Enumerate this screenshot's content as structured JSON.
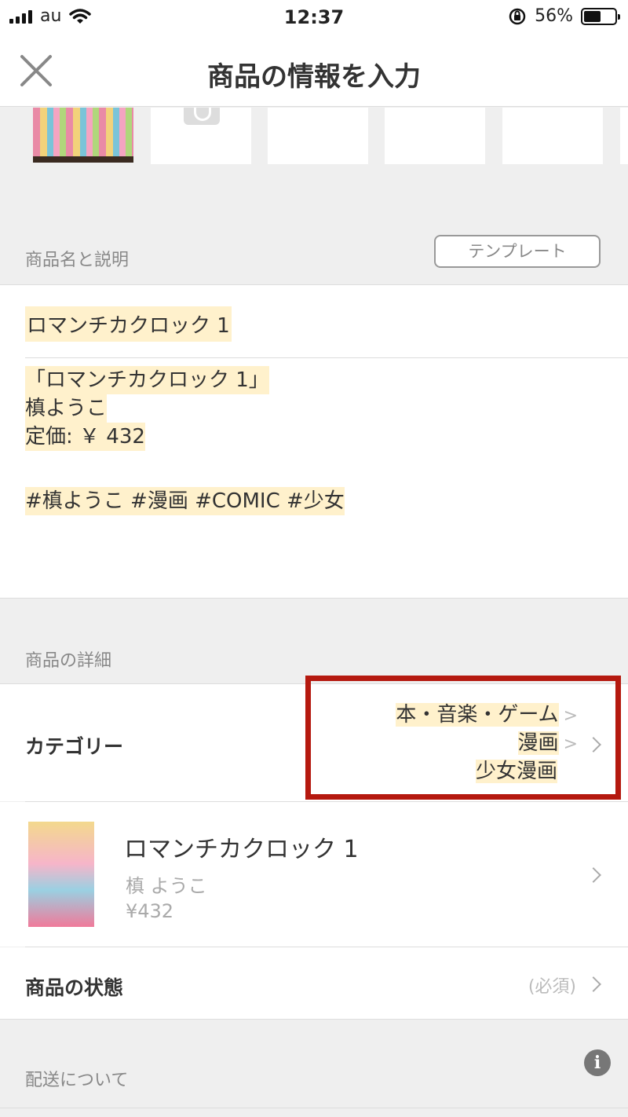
{
  "status_bar": {
    "carrier": "au",
    "time": "12:37",
    "battery": "56%",
    "battery_level": 0.56
  },
  "nav": {
    "title": "商品の情報を入力"
  },
  "name_section": {
    "label": "商品名と説明",
    "template_button": "テンプレート",
    "item_name": "ロマンチカクロック 1",
    "description": [
      "「ロマンチカクロック 1」",
      "槙ようこ",
      "定価: ￥ 432",
      "",
      "#槙ようこ #漫画 #COMIC #少女"
    ]
  },
  "details_section": {
    "label": "商品の詳細",
    "category_label": "カテゴリー",
    "category_path": [
      "本・音楽・ゲーム",
      "漫画",
      "少女漫画"
    ],
    "category_sep": ">",
    "product": {
      "title": "ロマンチカクロック 1",
      "author": "槙 ようこ",
      "price": "¥432"
    },
    "condition_label": "商品の状態",
    "condition_value": "(必須)"
  },
  "shipping_section": {
    "label": "配送について",
    "info_glyph": "i"
  },
  "colors": {
    "highlight": "#fff1cc",
    "annotation_red": "#b5190f",
    "background": "#efefef"
  },
  "icons": {
    "close": "close-icon",
    "camera": "camera-icon",
    "chevron": "chevron-right-icon",
    "info": "info-icon"
  }
}
